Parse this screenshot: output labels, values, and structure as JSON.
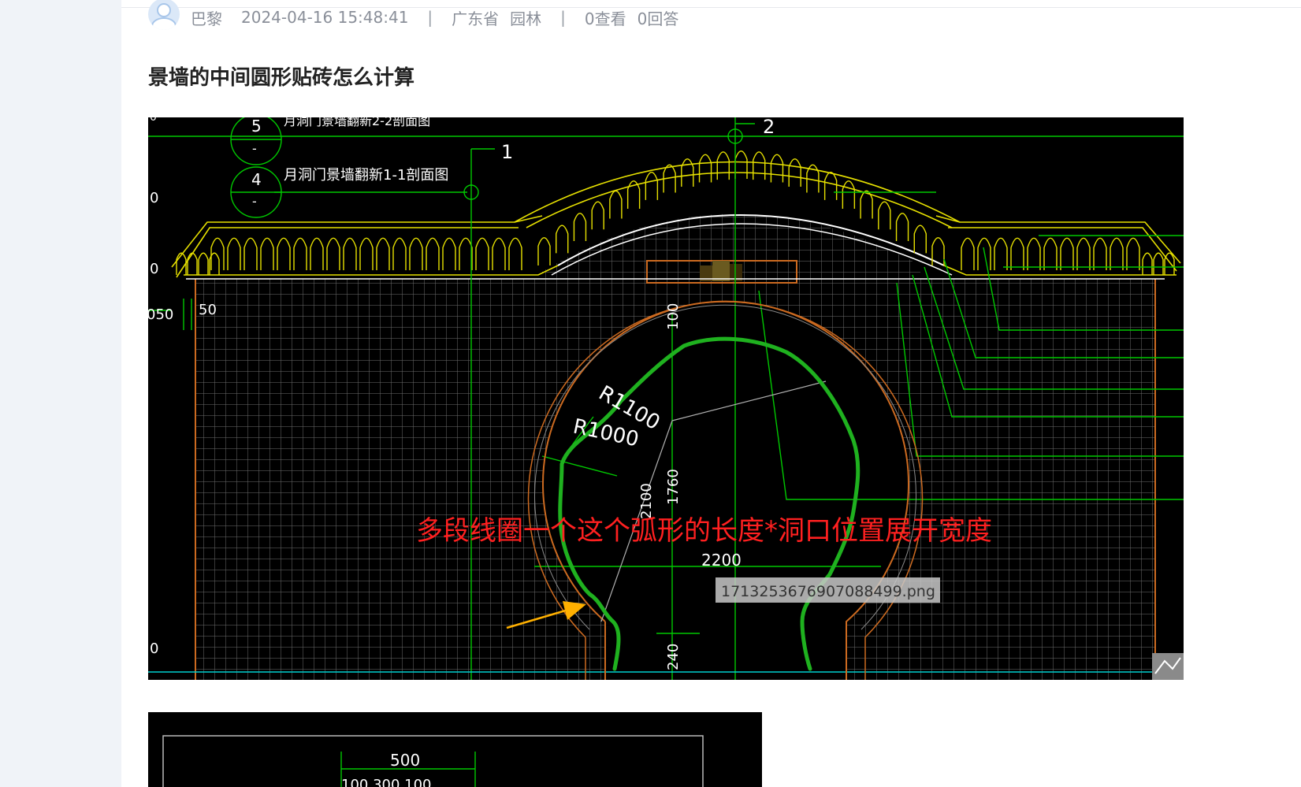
{
  "post": {
    "author": "巴黎",
    "timestamp": "2024-04-16 15:48:41",
    "sep1": "|",
    "province": "广东省",
    "category": "园林",
    "sep2": "|",
    "views": "0查看",
    "answers": "0回答",
    "title": "景墙的中间圆形贴砖怎么计算"
  },
  "image1": {
    "label_section_5": "月洞门景墙翻新2-2剖面图",
    "label_section_4": "月洞门景墙翻新1-1剖面图",
    "circle_5": "5",
    "circle_4": "4",
    "dash": "-",
    "mark_1": "1",
    "mark_2": "2",
    "dim_50": "50",
    "dim_050": "050",
    "dim_100": "100",
    "dim_R1100": "R1100",
    "dim_R1000": "R1000",
    "dim_2100": "2100",
    "dim_1760": "1760",
    "dim_2200": "2200",
    "dim_240": "240",
    "left_edge_1": "0",
    "left_edge_2": "0",
    "left_edge_3": "0",
    "left_edge_4": "0",
    "annotation": "多段线圈一个这个弧形的长度*洞口位置展开宽度",
    "filename_tooltip": "1713253676907088499.png",
    "colors": {
      "cad_bg": "#000000",
      "roof": "#e6e000",
      "green": "#00c800",
      "annotation_red": "#ff2020",
      "arrow": "#ffb000",
      "brick": "#cc6a20",
      "grid": "#6e6e6e"
    }
  },
  "image2": {
    "dim_500": "500",
    "dim_row": "100  300  100"
  }
}
